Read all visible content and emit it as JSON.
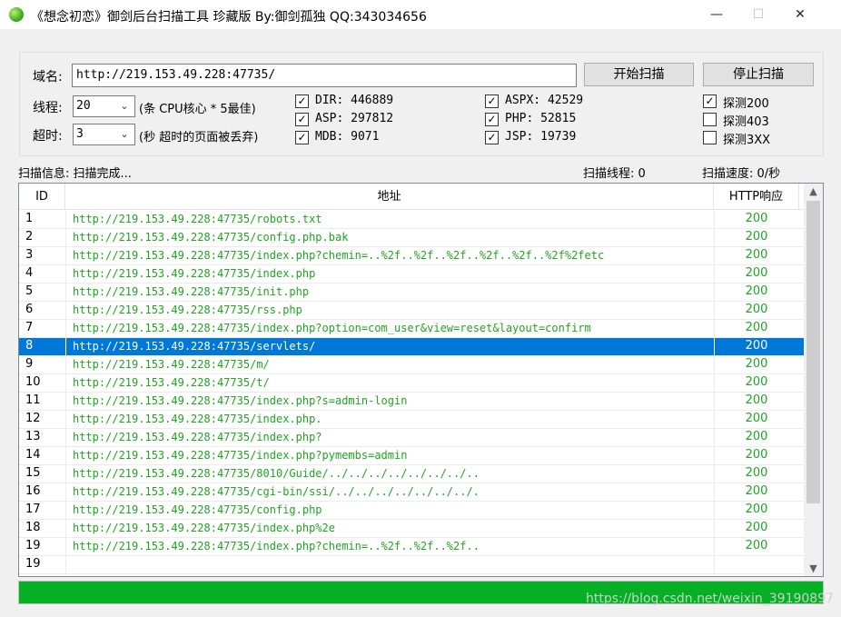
{
  "window": {
    "title": "《想念初恋》御剑后台扫描工具 珍藏版 By:御剑孤独 QQ:343034656",
    "min_glyph": "—",
    "max_glyph": "☐",
    "close_glyph": "✕"
  },
  "form": {
    "domain_label": "域名:",
    "domain_value": "http://219.153.49.228:47735/",
    "start_button": "开始扫描",
    "stop_button": "停止扫描",
    "threads_label": "线程:",
    "threads_value": "20",
    "threads_hint": "(条 CPU核心 * 5最佳)",
    "timeout_label": "超时:",
    "timeout_value": "3",
    "timeout_hint": "(秒 超时的页面被丢弃)",
    "checkboxes": {
      "dir": {
        "label": "DIR: 446889",
        "checked": true
      },
      "asp": {
        "label": "ASP: 297812",
        "checked": true
      },
      "mdb": {
        "label": "MDB: 9071",
        "checked": true
      },
      "aspx": {
        "label": "ASPX: 42529",
        "checked": true
      },
      "php": {
        "label": "PHP: 52815",
        "checked": true
      },
      "jsp": {
        "label": "JSP: 19739",
        "checked": true
      },
      "probe200": {
        "label": "探测200",
        "checked": true
      },
      "probe403": {
        "label": "探测403",
        "checked": false
      },
      "probe3xx": {
        "label": "探测3XX",
        "checked": false
      }
    },
    "check_glyph": "✓",
    "arrow_glyph": "⌄"
  },
  "status": {
    "info": "扫描信息: 扫描完成...",
    "threads": "扫描线程: 0",
    "speed": "扫描速度: 0/秒"
  },
  "table": {
    "headers": {
      "id": "ID",
      "url": "地址",
      "code": "HTTP响应"
    },
    "selected_index": 7,
    "rows": [
      {
        "id": "1",
        "url": "http://219.153.49.228:47735/robots.txt",
        "code": "200"
      },
      {
        "id": "2",
        "url": "http://219.153.49.228:47735/config.php.bak",
        "code": "200"
      },
      {
        "id": "3",
        "url": "http://219.153.49.228:47735/index.php?chemin=..%2f..%2f..%2f..%2f..%2f..%2f%2fetc",
        "code": "200"
      },
      {
        "id": "4",
        "url": "http://219.153.49.228:47735/index.php",
        "code": "200"
      },
      {
        "id": "5",
        "url": "http://219.153.49.228:47735/init.php",
        "code": "200"
      },
      {
        "id": "6",
        "url": "http://219.153.49.228:47735/rss.php",
        "code": "200"
      },
      {
        "id": "7",
        "url": "http://219.153.49.228:47735/index.php?option=com_user&view=reset&layout=confirm",
        "code": "200"
      },
      {
        "id": "8",
        "url": "http://219.153.49.228:47735/servlets/",
        "code": "200"
      },
      {
        "id": "9",
        "url": "http://219.153.49.228:47735/m/",
        "code": "200"
      },
      {
        "id": "10",
        "url": "http://219.153.49.228:47735/t/",
        "code": "200"
      },
      {
        "id": "11",
        "url": "http://219.153.49.228:47735/index.php?s=admin-login",
        "code": "200"
      },
      {
        "id": "12",
        "url": "http://219.153.49.228:47735/index.php.",
        "code": "200"
      },
      {
        "id": "13",
        "url": "http://219.153.49.228:47735/index.php?",
        "code": "200"
      },
      {
        "id": "14",
        "url": "http://219.153.49.228:47735/index.php?pymembs=admin",
        "code": "200"
      },
      {
        "id": "15",
        "url": "http://219.153.49.228:47735/8010/Guide/../../../../../../../..",
        "code": "200"
      },
      {
        "id": "16",
        "url": "http://219.153.49.228:47735/cgi-bin/ssi/../../../../../../../.",
        "code": "200"
      },
      {
        "id": "17",
        "url": "http://219.153.49.228:47735/config.php",
        "code": "200"
      },
      {
        "id": "18",
        "url": "http://219.153.49.228:47735/index.php%2e",
        "code": "200"
      },
      {
        "id": "19",
        "url": "http://219.153.49.228:47735/index.php?chemin=..%2f..%2f..%2f..",
        "code": "200"
      },
      {
        "id": "19",
        "url": "",
        "code": ""
      }
    ],
    "scroll_up_glyph": "▲",
    "scroll_down_glyph": "▼"
  },
  "progress": {
    "percent": 100
  },
  "watermark": "https://blog.csdn.net/weixin_39190897",
  "colors": {
    "ok_green": "#1fa51f",
    "selection": "#0078d7",
    "progress_green": "#06b025"
  }
}
